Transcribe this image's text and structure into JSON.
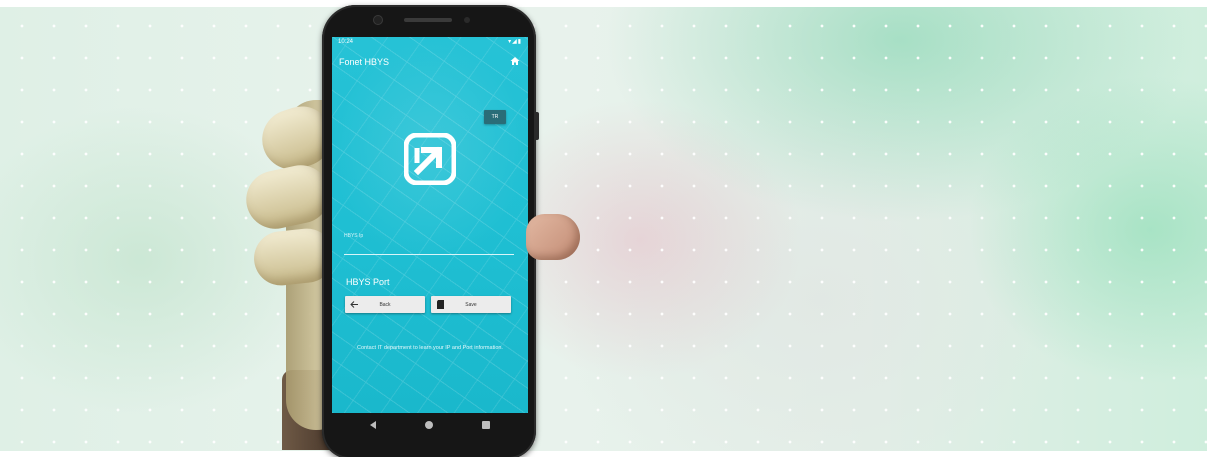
{
  "phone": {
    "status_time": "10:24",
    "status_icons": "▾◢▮",
    "app_title": "Fonet HBYS",
    "lang_badge": "TR",
    "ip_label": "HBYS Ip",
    "port_label": "HBYS Port",
    "back_button": "Back",
    "save_button": "Save",
    "info_text": "Contact IT department to learn your IP and Port information."
  },
  "colors": {
    "screen_accent": "#1fbfd3",
    "button_bg": "#ececec"
  },
  "icons": [
    "home-icon",
    "app-logo-icon",
    "arrow-left-icon",
    "sd-card-icon",
    "nav-back-icon",
    "nav-home-icon",
    "nav-recent-icon"
  ]
}
